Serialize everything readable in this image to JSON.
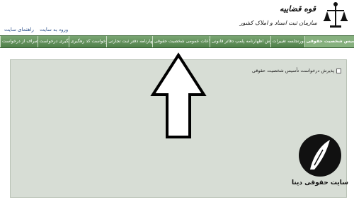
{
  "header": {
    "logo_title": "قوه قضاییه",
    "logo_subtitle": "سازمان ثبت اسناد و املاک کشور",
    "links": [
      "ورود به سایت",
      "راهنمای سایت"
    ]
  },
  "nav": {
    "tabs": [
      "تأسیس شخصیت حقوقی",
      "صورتجلسه تغییرات",
      "پذیرش اظهارنامه پلمپ دفاتر قانونی",
      "اطلاعات عمومی شخصیت حقوقی",
      "اظهارنامه دفتر ثبت تجارتی",
      "درخواست کد رهگیری",
      "پیگیری درخواست",
      "انصراف از درخواست"
    ]
  },
  "form": {
    "checkbox_label": "پذیرش درخواست تأسیس شخصیت حقوقی"
  },
  "watermark": {
    "text": "سایت حقوقی دینا"
  },
  "colors": {
    "nav_green": "#5f8c58",
    "panel_bg": "#d7ddd5"
  }
}
